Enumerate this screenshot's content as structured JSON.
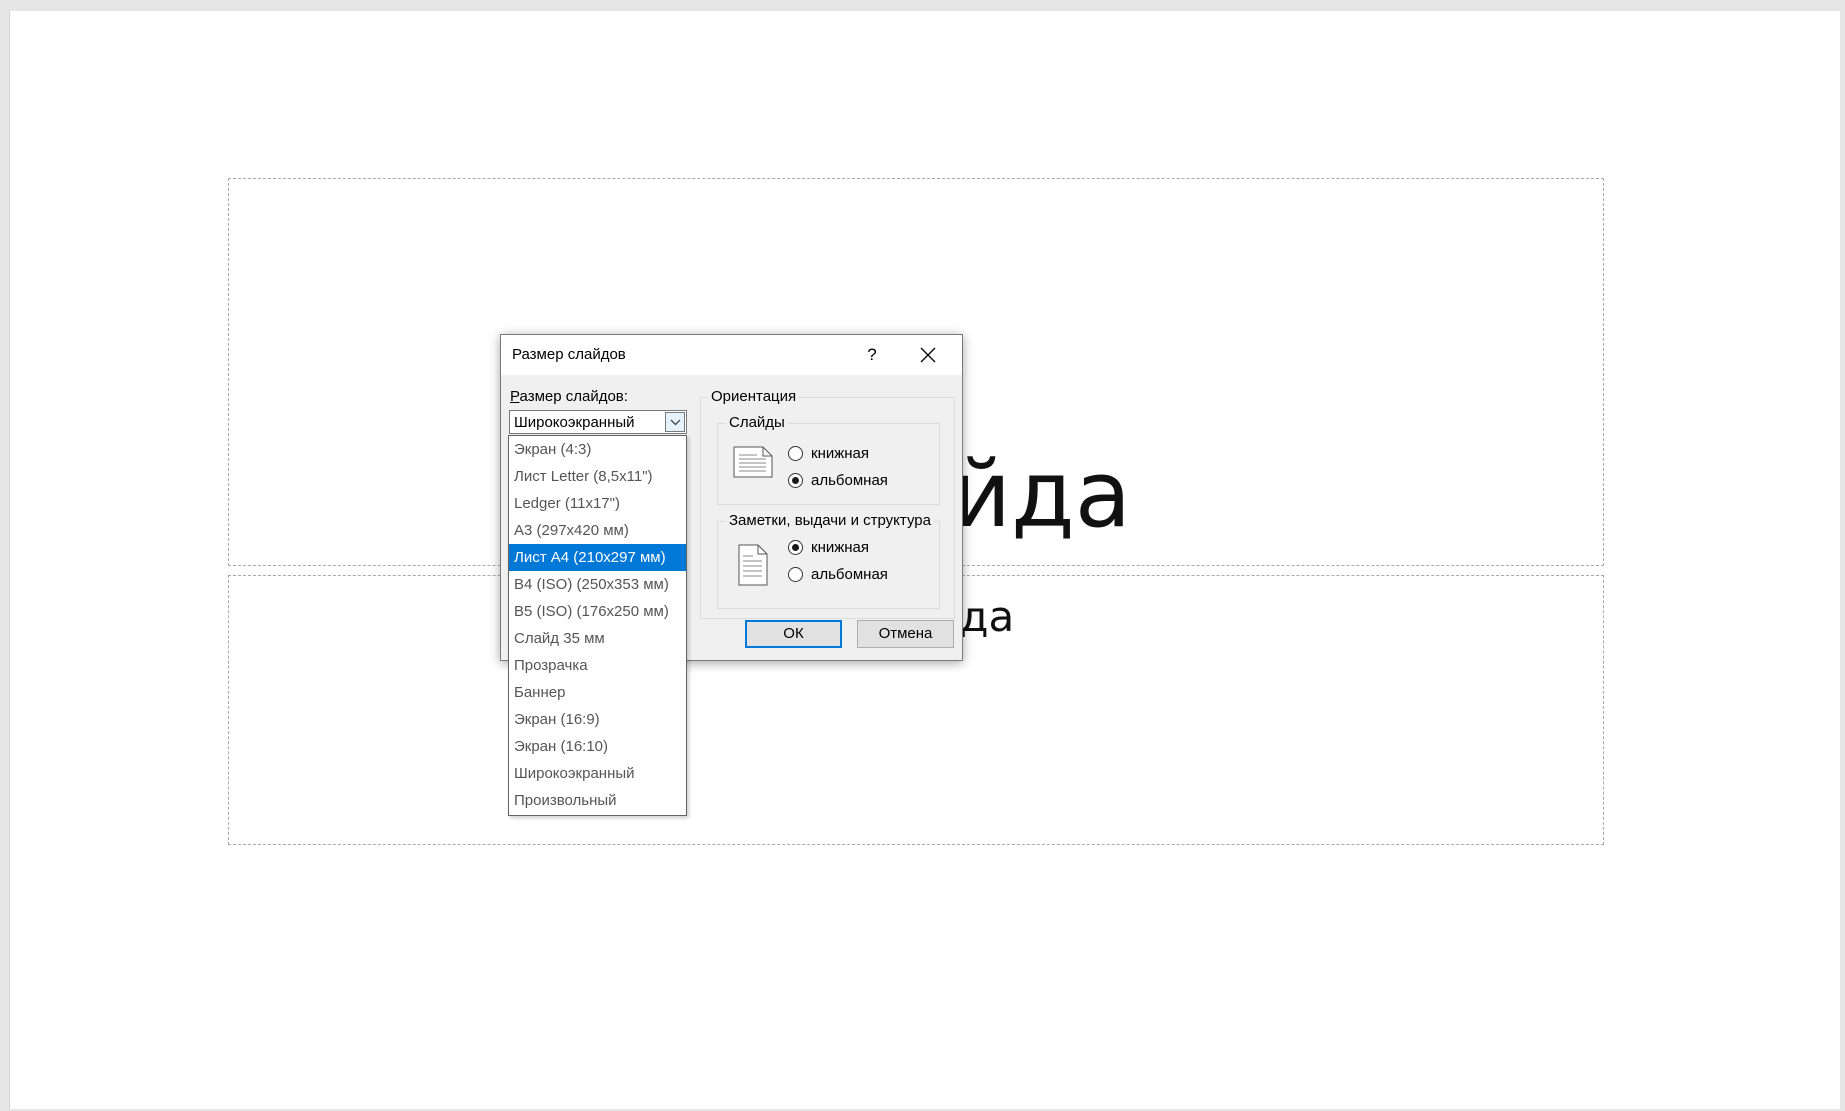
{
  "slide": {
    "title_text": "к слайда",
    "subtitle_text": "к слайда"
  },
  "dialog": {
    "title": "Размер слайдов",
    "help_label": "?",
    "size_label_prefix": "Р",
    "size_label_rest": "азмер слайдов:",
    "size_value": "Широкоэкранный",
    "orientation_label": "Ориентация",
    "slides_label": "Слайды",
    "slides_portrait": "книжная",
    "slides_landscape": "альбомная",
    "slides_selected": "landscape",
    "notes_label": "Заметки, выдачи и структура",
    "notes_portrait": "книжная",
    "notes_landscape": "альбомная",
    "notes_selected": "portrait",
    "ok_label": "ОК",
    "cancel_label": "Отмена"
  },
  "dropdown": {
    "items": [
      "Экран (4:3)",
      "Лист Letter (8,5x11\")",
      "Ledger (11x17\")",
      "A3 (297x420 мм)",
      "Лист A4 (210x297 мм)",
      "B4 (ISO) (250x353 мм)",
      "B5 (ISO) (176x250 мм)",
      "Слайд 35 мм",
      "Прозрачка",
      "Баннер",
      "Экран (16:9)",
      "Экран (16:10)",
      "Широкоэкранный",
      "Произвольный"
    ],
    "selected_index": 4
  },
  "colors": {
    "accent": "#0078d7"
  }
}
